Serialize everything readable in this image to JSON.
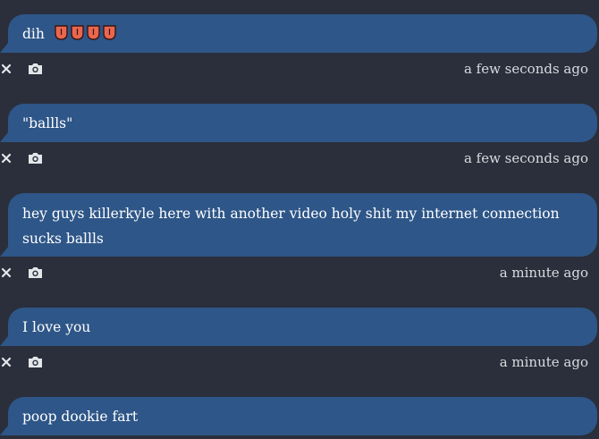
{
  "colors": {
    "background": "#2a2f3b",
    "bubble": "#2e5688",
    "text": "#ffffff",
    "timestamp": "#d9dbe0",
    "icon": "#e4e6ea"
  },
  "messages": [
    {
      "text": "dih",
      "emojis": [
        "tongue-emoji",
        "tongue-emoji",
        "tongue-emoji",
        "tongue-emoji"
      ],
      "timestamp": "a few seconds ago",
      "delete_icon": "close-icon",
      "screenshot_icon": "camera-icon"
    },
    {
      "text": "\"ballls\"",
      "timestamp": "a few seconds ago",
      "delete_icon": "close-icon",
      "screenshot_icon": "camera-icon"
    },
    {
      "text": "hey guys killerkyle here with another video holy shit my internet connection sucks ballls",
      "timestamp": "a minute ago",
      "delete_icon": "close-icon",
      "screenshot_icon": "camera-icon"
    },
    {
      "text": "I love you",
      "timestamp": "a minute ago",
      "delete_icon": "close-icon",
      "screenshot_icon": "camera-icon"
    },
    {
      "text": "poop dookie fart"
    }
  ]
}
